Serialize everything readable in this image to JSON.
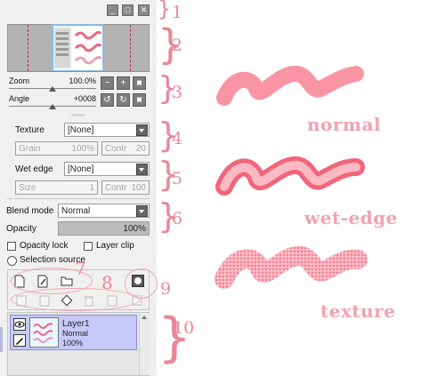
{
  "window_buttons": {
    "minimize": "_",
    "maximize": "□",
    "close": "✕"
  },
  "navigator": {
    "zoom_label": "Zoom",
    "zoom_value": "100.0%",
    "angle_label": "Angle",
    "angle_value": "+0008"
  },
  "brush": {
    "texture_label": "Texture",
    "texture_value": "[None]",
    "grain_label": "Grain",
    "grain_value": "100%",
    "contr_label": "Contr",
    "texture_contr_value": "20",
    "wet_edge_label": "Wet edge",
    "wet_edge_value": "[None]",
    "size_label": "Size",
    "size_value": "1",
    "wet_contr_value": "100"
  },
  "layer_props": {
    "blend_mode_label": "Blend mode",
    "blend_mode_value": "Normal",
    "opacity_label": "Opacity",
    "opacity_value": "100%",
    "opacity_fraction": 1.0,
    "opacity_lock_label": "Opacity lock",
    "layer_clip_label": "Layer clip",
    "selection_source_label": "Selection source"
  },
  "layer": {
    "name": "Layer1",
    "mode": "Normal",
    "opacity": "100%"
  },
  "annotations": [
    "1",
    "2",
    "3",
    "4",
    "5",
    "6",
    "7",
    "8",
    "9",
    "10"
  ],
  "strokes": {
    "normal": "normal",
    "wet_edge": "wet-edge",
    "texture": "texture"
  },
  "colors": {
    "stroke": "#f77a8c",
    "annotation": "#e8889a",
    "selection": "#c8c8f8"
  }
}
